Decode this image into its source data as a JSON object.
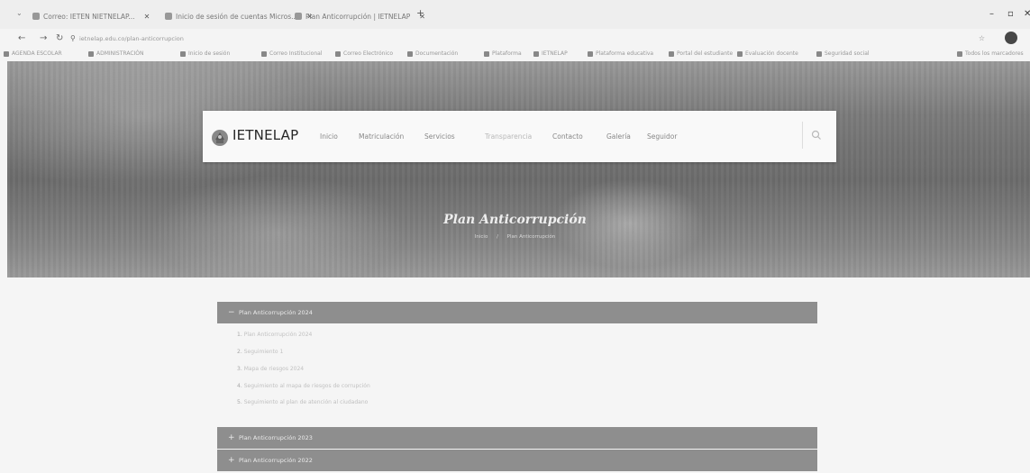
{
  "browser": {
    "tabs": [
      {
        "title": "Correo: IETEN NIETNELAP..."
      },
      {
        "title": "Inicio de sesión de cuentas Micros..."
      },
      {
        "title": "Plan Anticorrupción | IETNELAP"
      }
    ],
    "url": "ietnelap.edu.co/plan-anticorrupcion",
    "bookmarks": [
      "AGENDA ESCOLAR",
      "ADMINISTRACIÓN",
      "Inicio de sesión",
      "Correo Institucional",
      "Correo Electrónico",
      "Documentación",
      "Plataforma",
      "IETNELAP",
      "Plataforma educativa",
      "Portal del estudiante",
      "Evaluación docente",
      "Seguridad social",
      "Todos los marcadores"
    ]
  },
  "site": {
    "logo_text": "IETNELAP",
    "menu": [
      "Inicio",
      "Matriculación",
      "Servicios",
      "Transparencia",
      "Contacto",
      "Galería",
      "Seguidor"
    ],
    "active_menu_index": 3
  },
  "hero": {
    "title": "Plan Anticorrupción",
    "breadcrumb": [
      "Inicio",
      "Plan Anticorrupción"
    ]
  },
  "accordion": {
    "expanded": {
      "label": "Plan Anticorrupción 2024",
      "items": [
        {
          "num": "1.",
          "text": "Plan Anticorrupción 2024"
        },
        {
          "num": "2.",
          "text": "Seguimiento 1"
        },
        {
          "num": "3.",
          "text": "Mapa de riesgos 2024"
        },
        {
          "num": "4.",
          "text": "Seguimiento al mapa de riesgos de corrupción"
        },
        {
          "num": "5.",
          "text": "Seguimiento al plan de atención al ciudadano"
        }
      ]
    },
    "collapsed": [
      {
        "label": "Plan Anticorrupción 2023"
      },
      {
        "label": "Plan Anticorrupción 2022"
      }
    ]
  }
}
